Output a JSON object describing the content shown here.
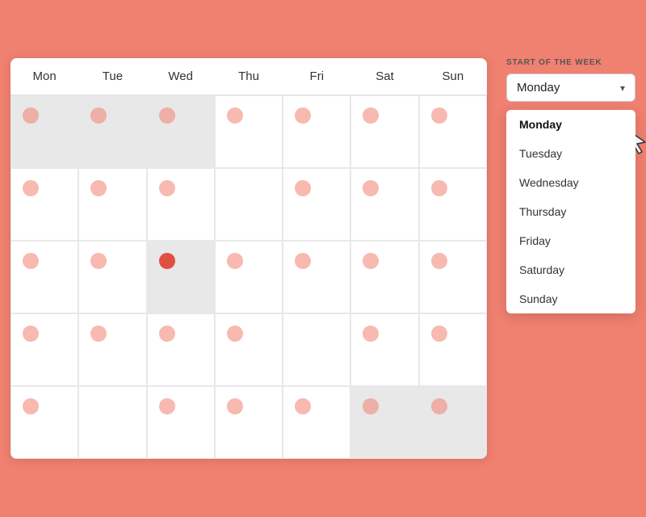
{
  "calendar": {
    "headers": [
      "Mon",
      "Tue",
      "Wed",
      "Thu",
      "Fri",
      "Sat",
      "Sun"
    ],
    "rows": [
      [
        {
          "greyed": true,
          "dot": true,
          "active": false
        },
        {
          "greyed": true,
          "dot": true,
          "active": false
        },
        {
          "greyed": true,
          "dot": true,
          "active": false
        },
        {
          "greyed": false,
          "dot": true,
          "active": false
        },
        {
          "greyed": false,
          "dot": true,
          "active": false
        },
        {
          "greyed": false,
          "dot": true,
          "active": false
        },
        {
          "greyed": false,
          "dot": true,
          "active": false
        }
      ],
      [
        {
          "greyed": false,
          "dot": true,
          "active": false
        },
        {
          "greyed": false,
          "dot": true,
          "active": false
        },
        {
          "greyed": false,
          "dot": true,
          "active": false
        },
        {
          "greyed": false,
          "dot": false,
          "active": false
        },
        {
          "greyed": false,
          "dot": true,
          "active": false
        },
        {
          "greyed": false,
          "dot": true,
          "active": false
        },
        {
          "greyed": false,
          "dot": true,
          "active": false
        }
      ],
      [
        {
          "greyed": false,
          "dot": true,
          "active": false
        },
        {
          "greyed": false,
          "dot": true,
          "active": false
        },
        {
          "greyed": true,
          "dot": true,
          "active": true
        },
        {
          "greyed": false,
          "dot": true,
          "active": false
        },
        {
          "greyed": false,
          "dot": true,
          "active": false
        },
        {
          "greyed": false,
          "dot": true,
          "active": false
        },
        {
          "greyed": false,
          "dot": true,
          "active": false
        }
      ],
      [
        {
          "greyed": false,
          "dot": true,
          "active": false
        },
        {
          "greyed": false,
          "dot": true,
          "active": false
        },
        {
          "greyed": false,
          "dot": true,
          "active": false
        },
        {
          "greyed": false,
          "dot": true,
          "active": false
        },
        {
          "greyed": false,
          "dot": false,
          "active": false
        },
        {
          "greyed": false,
          "dot": true,
          "active": false
        },
        {
          "greyed": false,
          "dot": true,
          "active": false
        }
      ],
      [
        {
          "greyed": false,
          "dot": true,
          "active": false
        },
        {
          "greyed": false,
          "dot": false,
          "active": false
        },
        {
          "greyed": false,
          "dot": true,
          "active": false
        },
        {
          "greyed": false,
          "dot": true,
          "active": false
        },
        {
          "greyed": false,
          "dot": true,
          "active": false
        },
        {
          "greyed": true,
          "dot": true,
          "active": false
        },
        {
          "greyed": true,
          "dot": true,
          "active": false
        }
      ]
    ]
  },
  "sidebar": {
    "label": "START OF THE WEEK",
    "button_value": "Monday",
    "chevron": "▾",
    "dropdown_items": [
      {
        "label": "Monday",
        "selected": true
      },
      {
        "label": "Tuesday",
        "selected": false
      },
      {
        "label": "Wednesday",
        "selected": false
      },
      {
        "label": "Thursday",
        "selected": false
      },
      {
        "label": "Friday",
        "selected": false
      },
      {
        "label": "Saturday",
        "selected": false
      },
      {
        "label": "Sunday",
        "selected": false
      }
    ]
  }
}
